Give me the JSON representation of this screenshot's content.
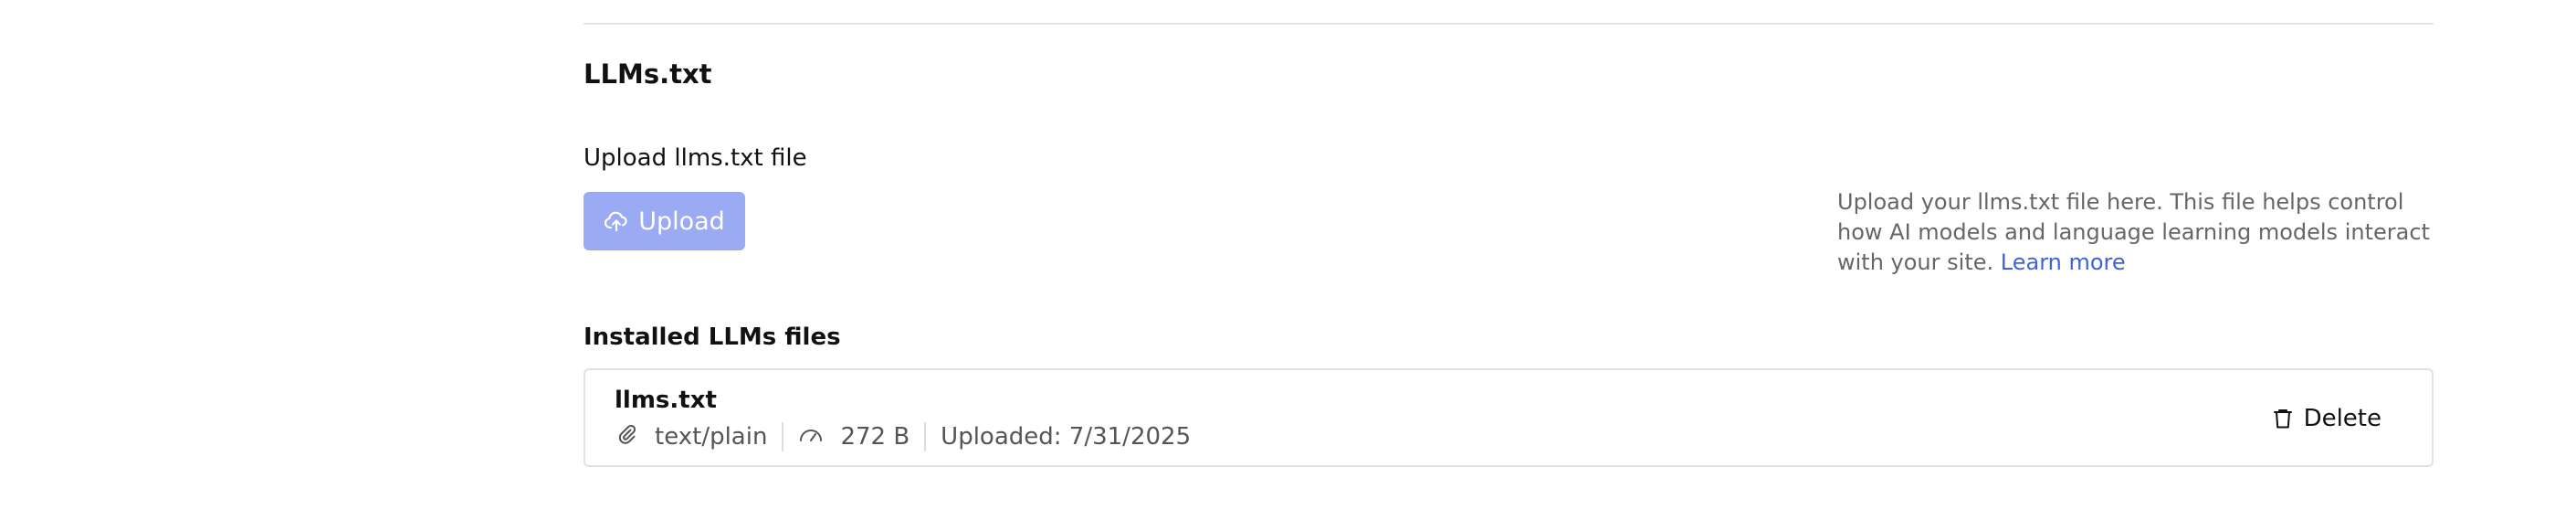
{
  "section": {
    "title": "LLMs.txt"
  },
  "upload": {
    "label": "Upload llms.txt file",
    "button_label": "Upload",
    "button_color": "#9aaaf3",
    "icon": "cloud-upload-icon"
  },
  "help": {
    "text": "Upload your llms.txt file here. This file helps control how AI models and language learning models interact with your site.",
    "link_label": "Learn more",
    "link_color": "#3f63d7"
  },
  "installed": {
    "title": "Installed LLMs files",
    "files": [
      {
        "name": "llms.txt",
        "mime_type": "text/plain",
        "mime_icon": "paperclip-icon",
        "size": "272 B",
        "size_icon": "gauge-icon",
        "uploaded": "Uploaded: 7/31/2025",
        "delete_label": "Delete",
        "delete_icon": "trash-icon"
      }
    ]
  }
}
